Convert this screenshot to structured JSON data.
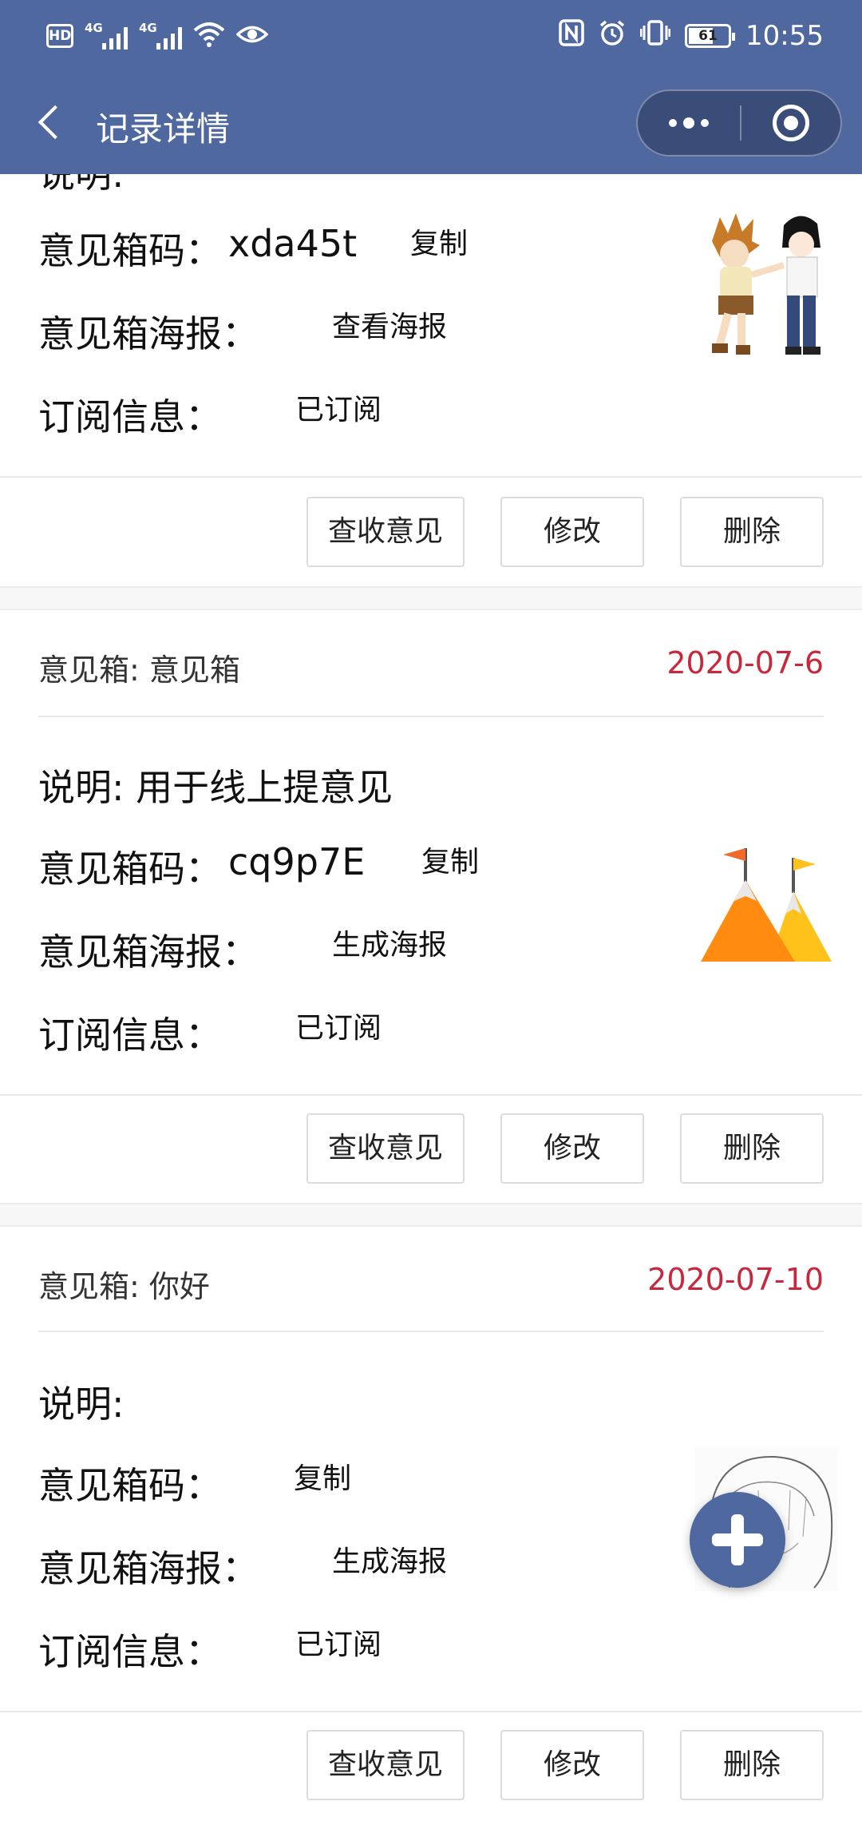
{
  "status_bar": {
    "hd_label": "HD",
    "sim1_label": "1",
    "net1": "4G",
    "net2": "4G",
    "battery": "61",
    "time": "10:55"
  },
  "navbar": {
    "title": "记录详情"
  },
  "cards": [
    {
      "header_label": "",
      "date": "",
      "desc_label": "说明:",
      "code_label": "意见箱码：",
      "code_value": "xda45t",
      "copy_label": "复制",
      "poster_label": "意见箱海报：",
      "poster_action": "查看海报",
      "sub_label": "订阅信息：",
      "sub_value": "已订阅",
      "btn_receive": "查收意见",
      "btn_edit": "修改",
      "btn_delete": "删除",
      "image_icon": "anime-characters-image"
    },
    {
      "header_label": "意见箱: 意见箱",
      "date": "2020-07-6",
      "desc_label": "说明: 用于线上提意见",
      "code_label": "意见箱码：",
      "code_value": "cq9p7E",
      "copy_label": "复制",
      "poster_label": "意见箱海报：",
      "poster_action": "生成海报",
      "sub_label": "订阅信息：",
      "sub_value": "已订阅",
      "btn_receive": "查收意见",
      "btn_edit": "修改",
      "btn_delete": "删除",
      "image_icon": "mountain-flags-image"
    },
    {
      "header_label": "意见箱: 你好",
      "date": "2020-07-10",
      "desc_label": "说明:",
      "code_label": "意见箱码：",
      "code_value": "",
      "copy_label": "复制",
      "poster_label": "意见箱海报：",
      "poster_action": "生成海报",
      "sub_label": "订阅信息：",
      "sub_value": "已订阅",
      "btn_receive": "查收意见",
      "btn_edit": "修改",
      "btn_delete": "删除",
      "image_icon": "sketch-girl-image"
    }
  ],
  "fab": {
    "icon": "plus-icon"
  },
  "colors": {
    "header_bg": "#5068a0",
    "date": "#c8283c"
  }
}
